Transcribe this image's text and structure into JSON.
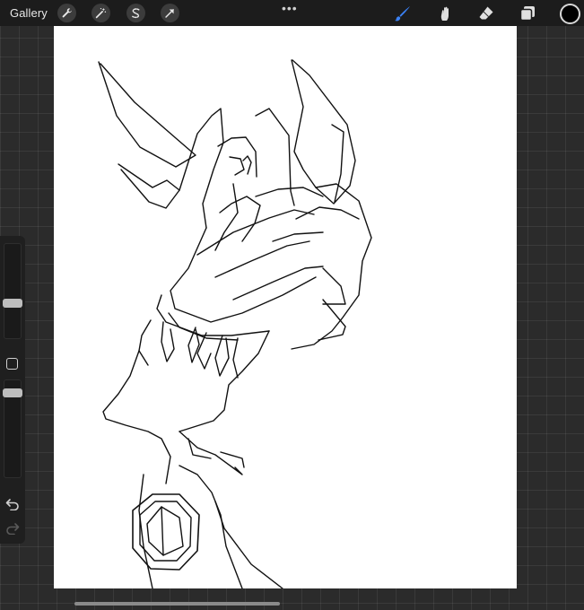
{
  "app": {
    "gallery_label": "Gallery"
  },
  "top_toolbar": {
    "left_tools": [
      "wrench-icon",
      "magic-wand-icon",
      "selection-icon",
      "transform-arrow-icon"
    ],
    "more_menu": "•••",
    "right_tools": [
      "brush-icon",
      "smudge-icon",
      "eraser-icon",
      "layers-icon"
    ],
    "active_tool": "brush-icon",
    "active_color": "#000000",
    "accent_color": "#3b82f6"
  },
  "sidebar": {
    "brush_size_level": 0.55,
    "opacity_level": 0.95,
    "controls": [
      "brush-size-slider",
      "modify-button",
      "opacity-slider",
      "undo-icon",
      "redo-icon"
    ]
  },
  "canvas": {
    "background_color": "#ffffff",
    "content": "line-art-drawing"
  }
}
